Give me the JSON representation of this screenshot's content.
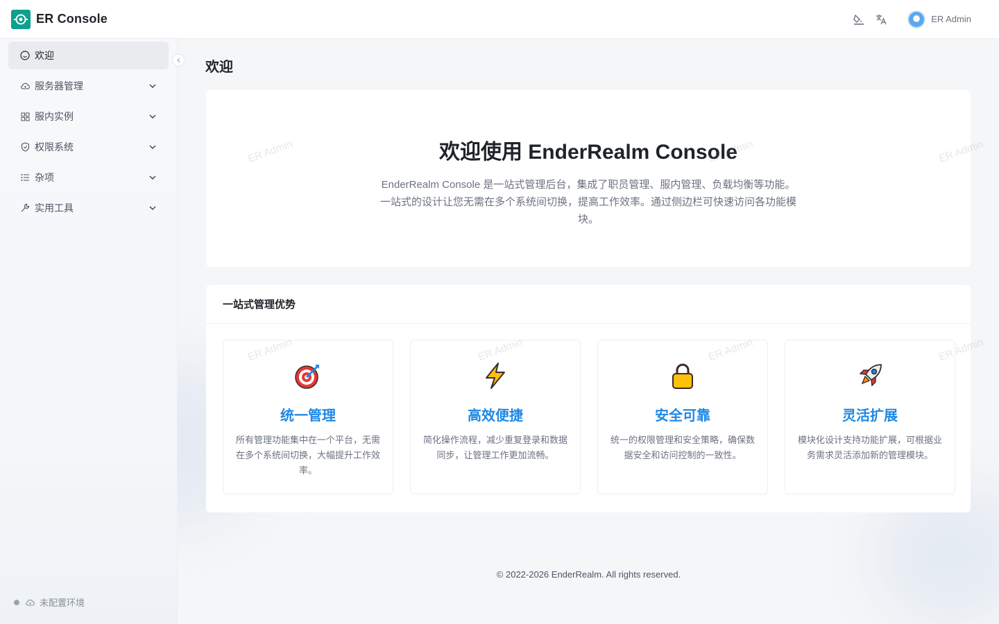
{
  "app": {
    "title": "ER Console",
    "accent_color": "#0e9f8e"
  },
  "header": {
    "icons": [
      "theme-brush-icon",
      "translate-icon"
    ],
    "user_name": "ER Admin"
  },
  "sidebar": {
    "items": [
      {
        "label": "欢迎",
        "icon": "smile-icon",
        "active": true
      },
      {
        "label": "服务器管理",
        "icon": "cloud-icon",
        "expandable": true
      },
      {
        "label": "服内实例",
        "icon": "grid-icon",
        "expandable": true
      },
      {
        "label": "权限系统",
        "icon": "shield-icon",
        "expandable": true
      },
      {
        "label": "杂项",
        "icon": "list-icon",
        "expandable": true
      },
      {
        "label": "实用工具",
        "icon": "wrench-icon",
        "expandable": true
      }
    ],
    "env_status": "未配置环境"
  },
  "main": {
    "page_title": "欢迎",
    "hero": {
      "title": "欢迎使用 EnderRealm Console",
      "description": "EnderRealm Console 是一站式管理后台，集成了职员管理、服内管理、负载均衡等功能。一站式的设计让您无需在多个系统间切换，提高工作效率。通过侧边栏可快速访问各功能模块。"
    },
    "advantages": {
      "heading": "一站式管理优势",
      "cards": [
        {
          "icon": "target-icon",
          "title": "统一管理",
          "desc": "所有管理功能集中在一个平台，无需在多个系统间切换，大幅提升工作效率。"
        },
        {
          "icon": "lightning-icon",
          "title": "高效便捷",
          "desc": "简化操作流程，减少重复登录和数据同步，让管理工作更加流畅。"
        },
        {
          "icon": "lock-icon",
          "title": "安全可靠",
          "desc": "统一的权限管理和安全策略，确保数据安全和访问控制的一致性。"
        },
        {
          "icon": "rocket-icon",
          "title": "灵活扩展",
          "desc": "模块化设计支持功能扩展，可根据业务需求灵活添加新的管理模块。"
        }
      ]
    },
    "footer": "© 2022-2026 EnderRealm. All rights reserved."
  },
  "watermark_text": "ER Admin"
}
